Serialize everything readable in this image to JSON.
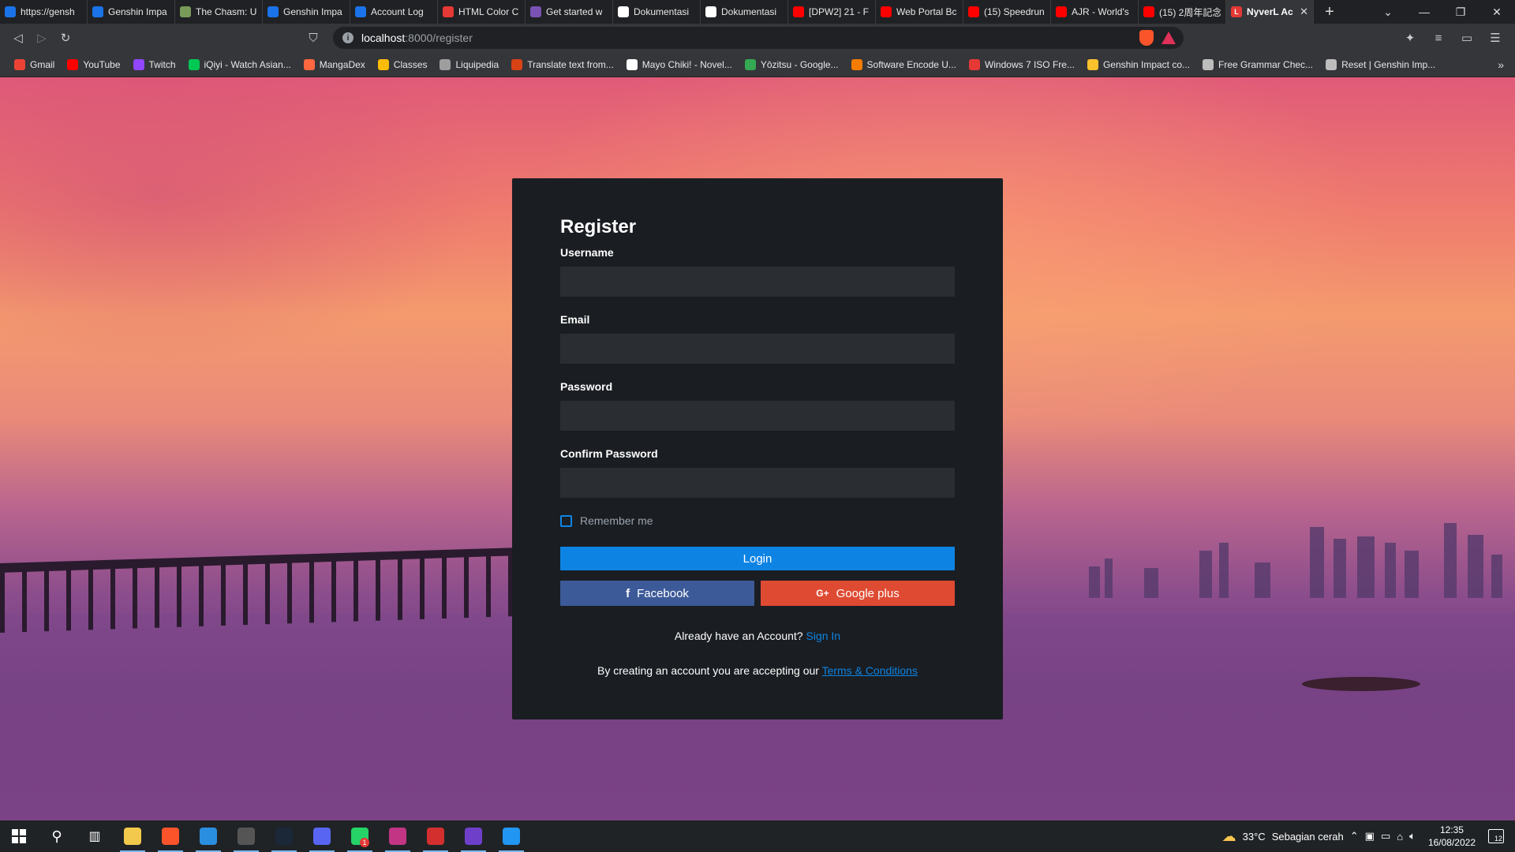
{
  "browser": {
    "tabs": [
      {
        "title": "https://gensh",
        "color": "#1a73e8"
      },
      {
        "title": "Genshin Impa",
        "color": "#1a73e8"
      },
      {
        "title": "The Chasm: U",
        "color": "#7a9a5a"
      },
      {
        "title": "Genshin Impa",
        "color": "#1a73e8"
      },
      {
        "title": "Account Log",
        "color": "#1a73e8"
      },
      {
        "title": "HTML Color C",
        "color": "#e53935"
      },
      {
        "title": "Get started w",
        "color": "#7952b3"
      },
      {
        "title": "Dokumentasi",
        "color": "#ffffff"
      },
      {
        "title": "Dokumentasi",
        "color": "#ffffff"
      },
      {
        "title": "[DPW2] 21 - F",
        "color": "#ff0000"
      },
      {
        "title": "Web Portal Bc",
        "color": "#ff0000"
      },
      {
        "title": "(15) Speedrun",
        "color": "#ff0000"
      },
      {
        "title": "AJR - World's",
        "color": "#ff0000"
      },
      {
        "title": "(15) 2周年記念",
        "color": "#ff0000"
      }
    ],
    "active_tab": {
      "title": "NyverL Ac",
      "color": "#e53935"
    },
    "new_tab": "+",
    "url_host": "localhost",
    "url_path": ":8000/register",
    "bookmarks": [
      {
        "label": "Gmail",
        "color": "#ea4335"
      },
      {
        "label": "YouTube",
        "color": "#ff0000"
      },
      {
        "label": "Twitch",
        "color": "#9146ff"
      },
      {
        "label": "iQiyi - Watch Asian...",
        "color": "#00c853"
      },
      {
        "label": "MangaDex",
        "color": "#ff6740"
      },
      {
        "label": "Classes",
        "color": "#fbbc04"
      },
      {
        "label": "Liquipedia",
        "color": "#9e9e9e"
      },
      {
        "label": "Translate text from...",
        "color": "#d84315"
      },
      {
        "label": "Mayo Chiki! - Novel...",
        "color": "#ffffff"
      },
      {
        "label": "Yōzitsu - Google...",
        "color": "#34a853"
      },
      {
        "label": "Software Encode U...",
        "color": "#f57c00"
      },
      {
        "label": "Windows 7 ISO Fre...",
        "color": "#e53935"
      },
      {
        "label": "Genshin Impact co...",
        "color": "#fbc02d"
      },
      {
        "label": "Free Grammar Chec...",
        "color": "#bdbdbd"
      },
      {
        "label": "Reset | Genshin Imp...",
        "color": "#bdbdbd"
      }
    ],
    "bookmarks_more": "»"
  },
  "form": {
    "title": "Register",
    "username_label": "Username",
    "username_value": "",
    "email_label": "Email",
    "email_value": "",
    "password_label": "Password",
    "password_value": "",
    "confirm_password_label": "Confirm Password",
    "confirm_password_value": "",
    "remember_label": "Remember me",
    "remember_checked": false,
    "login_button": "Login",
    "facebook_button": "Facebook",
    "facebook_icon": "f",
    "google_button": "Google plus",
    "google_icon": "G+",
    "already_text": "Already have an Account?",
    "sign_in_link": "Sign In",
    "terms_text": "By creating an account you are accepting our",
    "terms_link": "Terms & Conditions",
    "accent_color": "#0d84e3",
    "facebook_color": "#3d5a98",
    "google_color": "#df4a32"
  },
  "taskbar": {
    "apps": [
      {
        "name": "file-explorer",
        "color": "#f2c94c"
      },
      {
        "name": "brave",
        "color": "#fb542b"
      },
      {
        "name": "vscode",
        "color": "#2a8ee0"
      },
      {
        "name": "obs",
        "color": "#555555"
      },
      {
        "name": "steam",
        "color": "#1b2838"
      },
      {
        "name": "discord",
        "color": "#5865f2"
      },
      {
        "name": "whatsapp",
        "color": "#25d366"
      },
      {
        "name": "instagram",
        "color": "#c13584"
      },
      {
        "name": "wps-office",
        "color": "#d32f2f"
      },
      {
        "name": "github-desktop",
        "color": "#6e40c9"
      },
      {
        "name": "photos",
        "color": "#2196f3"
      }
    ],
    "whatsapp_badge": "1",
    "weather": "33°C",
    "weather_desc": "Sebagian cerah",
    "time": "12:35",
    "date": "16/08/2022",
    "notifications": "12"
  }
}
